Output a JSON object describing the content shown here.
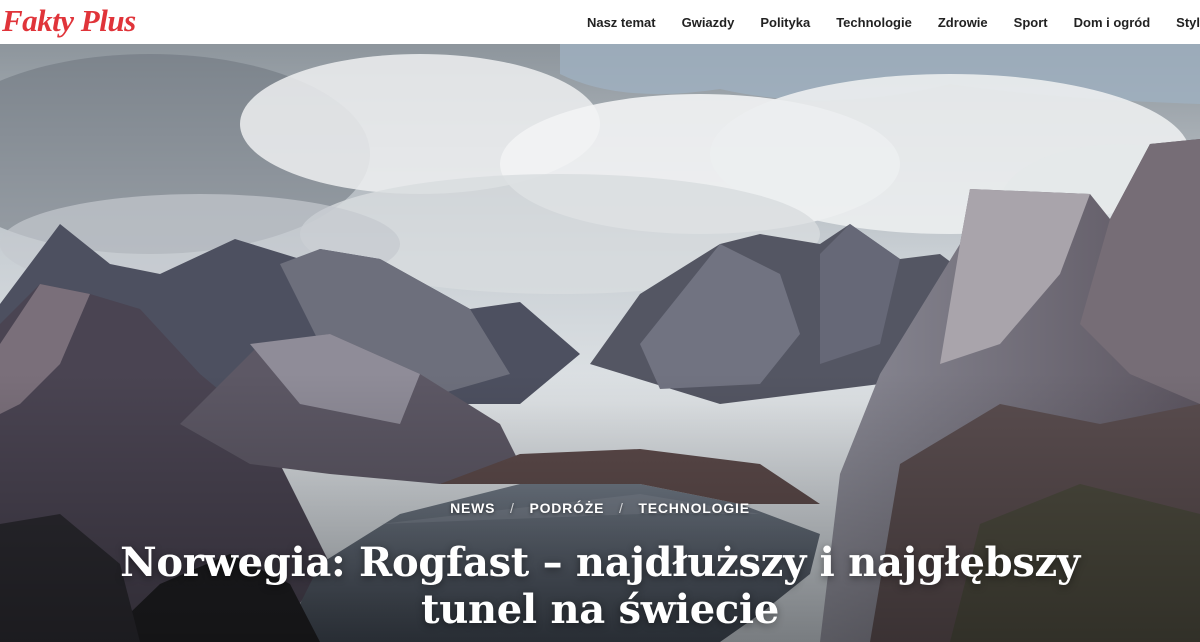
{
  "site": {
    "logo": "Fakty Plus",
    "brand_color": "#e0343a"
  },
  "nav": {
    "items": [
      "Nasz temat",
      "Gwiazdy",
      "Polityka",
      "Technologie",
      "Zdrowie",
      "Sport",
      "Dom i ogród",
      "Styl"
    ]
  },
  "hero": {
    "categories": [
      "NEWS",
      "PODRÓŻE",
      "TECHNOLOGIE"
    ],
    "separator": "/",
    "title": "Norwegia: Rogfast – najdłuższy i najgłębszy tunel na świecie"
  }
}
